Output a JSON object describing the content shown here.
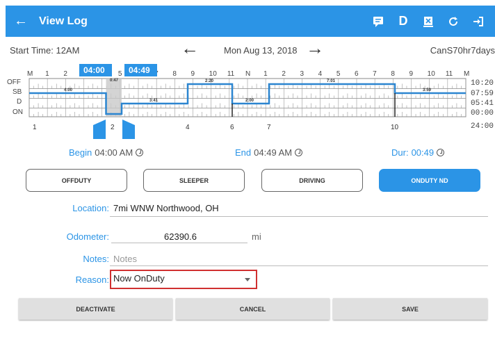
{
  "appbar": {
    "title": "View Log",
    "back_icon": "←",
    "actions": [
      {
        "name": "message-icon"
      },
      {
        "name": "d-icon",
        "label": "D"
      },
      {
        "name": "close-file-icon"
      },
      {
        "name": "refresh-icon"
      },
      {
        "name": "logout-icon"
      }
    ],
    "color": "#2b94e6"
  },
  "nav": {
    "start_time": "Start Time: 12AM",
    "date": "Mon Aug 13, 2018",
    "cycle": "CanS70hr7days"
  },
  "graph": {
    "hour_labels": [
      "M",
      "1",
      "2",
      "3",
      "4",
      "5",
      "6",
      "7",
      "8",
      "9",
      "10",
      "11",
      "N",
      "1",
      "2",
      "3",
      "4",
      "5",
      "6",
      "7",
      "8",
      "9",
      "10",
      "11",
      "M"
    ],
    "row_labels": [
      "OFF",
      "SB",
      "D",
      "ON"
    ],
    "totals": [
      "10:20",
      "07:59",
      "05:41",
      "00:00",
      "24:00"
    ],
    "selection_start": "04:00",
    "selection_end": "04:49",
    "segment_labels": [
      "4:00",
      "0:47",
      "3:41",
      "2:20",
      "2:00",
      "7:01",
      "3:59"
    ],
    "event_numbers": [
      "1",
      "2",
      "4",
      "6",
      "7",
      "10"
    ]
  },
  "times": {
    "begin_label": "Begin",
    "begin_value": "04:00 AM",
    "end_label": "End",
    "end_value": "04:49 AM",
    "dur_label": "Dur:",
    "dur_value": "00:49"
  },
  "status_buttons": {
    "offduty": "OFFDUTY",
    "sleeper": "SLEEPER",
    "driving": "DRIVING",
    "onduty": "ONDUTY ND"
  },
  "form": {
    "location_label": "Location:",
    "location_value": "7mi WNW Northwood, OH",
    "odometer_label": "Odometer:",
    "odometer_value": "62390.6",
    "odometer_unit": "mi",
    "notes_label": "Notes:",
    "notes_placeholder": "Notes",
    "reason_label": "Reason:",
    "reason_value": "Now OnDuty"
  },
  "bottom_buttons": {
    "deactivate": "DEACTIVATE",
    "cancel": "CANCEL",
    "save": "SAVE"
  }
}
